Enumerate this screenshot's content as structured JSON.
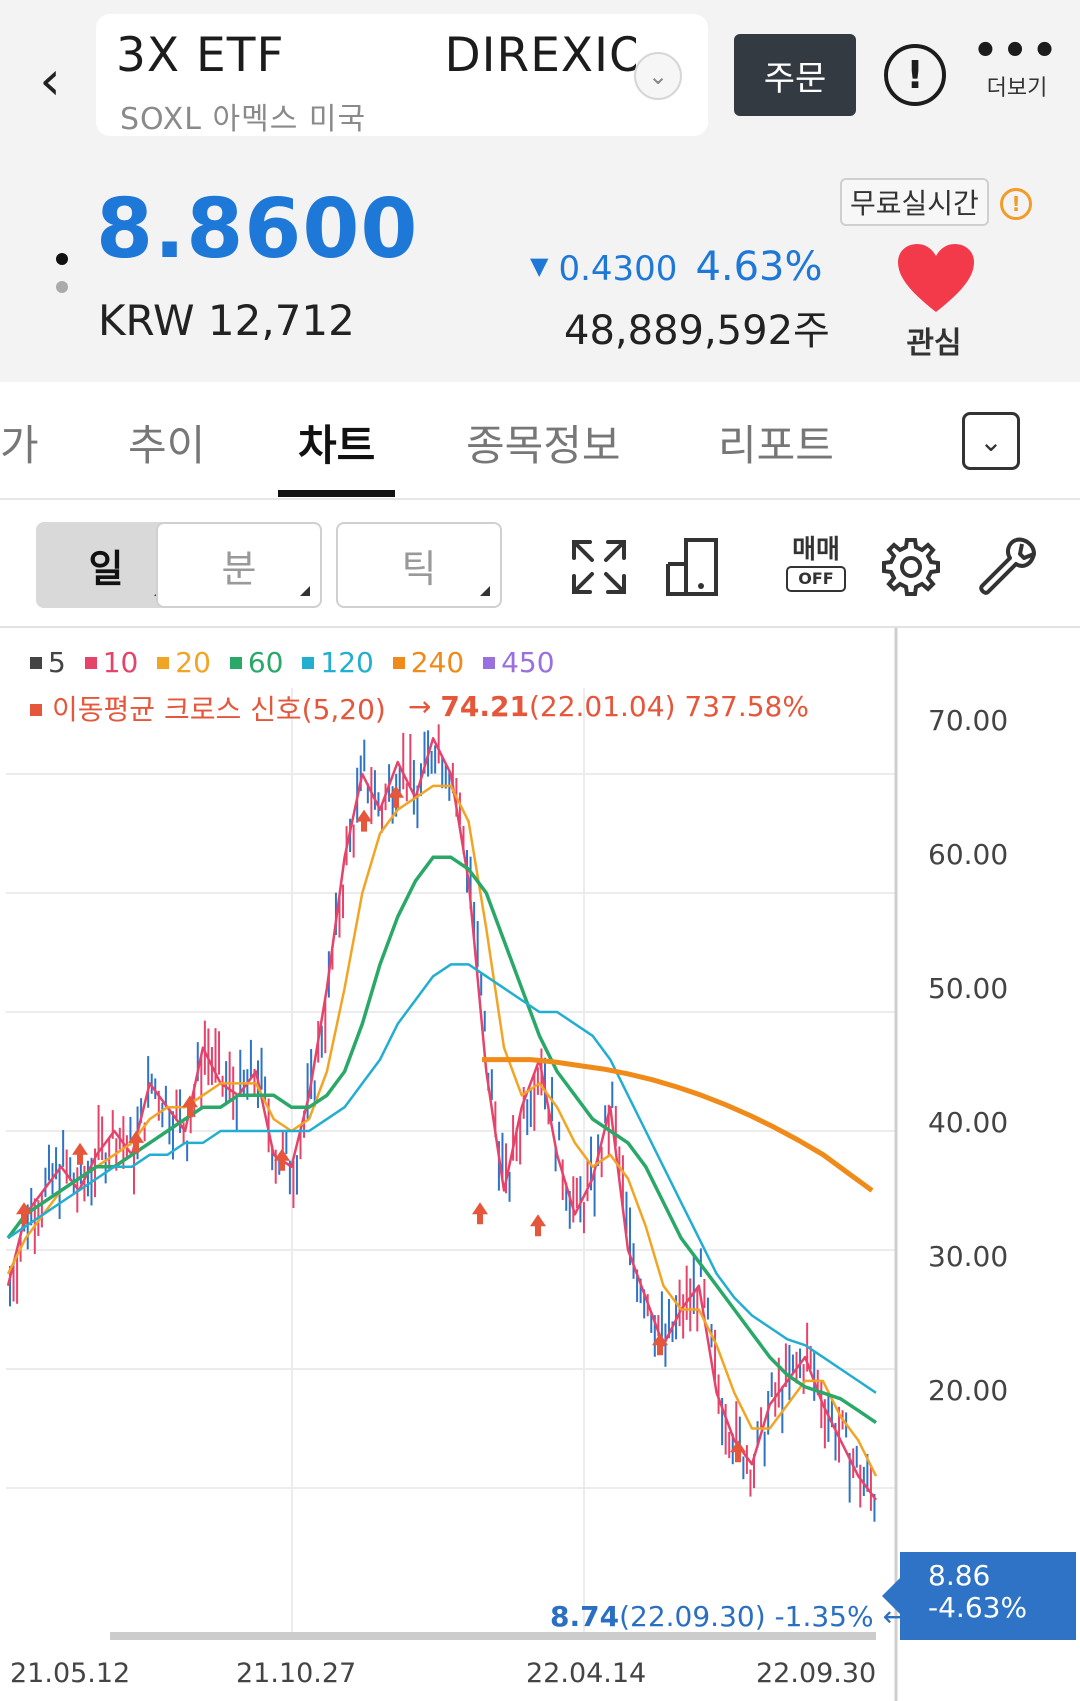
{
  "header": {
    "back_icon": "chevron-left-icon",
    "ticker_left": "3X ETF",
    "ticker_right": "DIREXIO",
    "subtitle": "SOXL 아멕스 미국",
    "order_label": "주문",
    "more_label": "더보기"
  },
  "quote": {
    "price": "8.8600",
    "krw": "KRW 12,712",
    "change_abs": "0.4300",
    "change_pct": "4.63%",
    "volume": "48,889,592주",
    "realtime_label": "무료실시간",
    "watch_label": "관심",
    "down_color": "#1e78d8",
    "heart_color": "#f23a4a"
  },
  "tabs": {
    "items": [
      "가",
      "추이",
      "차트",
      "종목정보",
      "리포트"
    ],
    "active": "차트"
  },
  "toolbar": {
    "periods": [
      "일",
      "분",
      "틱"
    ],
    "active_period": "일",
    "trade_label": "매매",
    "trade_state": "OFF"
  },
  "chart_legend": {
    "ma": [
      {
        "label": "5",
        "color": "#444444"
      },
      {
        "label": "10",
        "color": "#e6436b"
      },
      {
        "label": "20",
        "color": "#f2a524"
      },
      {
        "label": "60",
        "color": "#2aa868"
      },
      {
        "label": "120",
        "color": "#22aed1"
      },
      {
        "label": "240",
        "color": "#f08a18"
      },
      {
        "label": "450",
        "color": "#9a6fe0"
      }
    ],
    "signal_label": "이동평균 크로스 신호(5,20)",
    "high_value": "74.21",
    "high_date": "(22.01.04) 737.58%",
    "low_value": "8.74",
    "low_date": "(22.09.30) -1.35%",
    "current_value": "8.86",
    "current_pct": "-4.63%"
  },
  "chart_data": {
    "type": "line",
    "y_ticks": [
      "70.00",
      "60.00",
      "50.00",
      "40.00",
      "30.00",
      "20.00"
    ],
    "x_ticks": [
      "21.05.12",
      "21.10.27",
      "22.04.14",
      "22.09.30"
    ],
    "ylim": [
      8,
      75
    ],
    "series": [
      {
        "name": "5",
        "color": "#e6436b",
        "values": [
          27,
          33,
          35,
          37,
          35,
          38,
          40,
          38,
          44,
          42,
          40,
          47,
          44,
          43,
          45,
          38,
          37,
          43,
          52,
          63,
          70,
          67,
          71,
          68,
          73,
          70,
          61,
          45,
          35,
          42,
          46,
          38,
          33,
          36,
          42,
          30,
          26,
          22,
          25,
          27,
          18,
          14,
          12,
          17,
          19,
          21,
          17,
          14,
          11,
          9
        ]
      },
      {
        "name": "20",
        "color": "#f2a524",
        "values": [
          28,
          31,
          33,
          35,
          36,
          37,
          38,
          39,
          41,
          42,
          42,
          43,
          44,
          44,
          44,
          41,
          40,
          41,
          45,
          52,
          60,
          65,
          67,
          68,
          69,
          69,
          66,
          57,
          47,
          43,
          44,
          42,
          39,
          37,
          38,
          36,
          32,
          27,
          25,
          25,
          22,
          18,
          15,
          15,
          17,
          19,
          19,
          16,
          14,
          11
        ]
      },
      {
        "name": "60",
        "color": "#2aa868",
        "values": [
          31,
          33,
          34,
          35,
          36,
          37,
          37,
          38,
          39,
          40,
          41,
          42,
          42,
          43,
          43,
          43,
          42,
          42,
          43,
          45,
          49,
          54,
          58,
          61,
          63,
          63,
          62,
          60,
          56,
          52,
          48,
          45,
          43,
          41,
          40,
          39,
          37,
          34,
          31,
          29,
          27,
          25,
          23,
          21,
          19.5,
          18.5,
          18,
          17.5,
          16.5,
          15.5
        ]
      },
      {
        "name": "120",
        "color": "#22aed1",
        "values": [
          31,
          32,
          33,
          34,
          35,
          36,
          37,
          37,
          38,
          38,
          39,
          39,
          40,
          40,
          40,
          40,
          40,
          40,
          41,
          42,
          44,
          46,
          49,
          51,
          53,
          54,
          54,
          53,
          52,
          51,
          50,
          50,
          49,
          48,
          46,
          43,
          40,
          37,
          34,
          31,
          28,
          26,
          24.5,
          23.5,
          22.5,
          22,
          21,
          20,
          19,
          18
        ]
      },
      {
        "name": "240",
        "color": "#f08a18",
        "values": [
          46,
          46,
          46,
          45.8,
          45.5,
          45.2,
          44.8,
          44.3,
          43.7,
          43,
          42.2,
          41.3,
          40.3,
          39.2,
          38,
          36.5,
          35
        ]
      }
    ],
    "high": 74.21,
    "low": 8.74,
    "current": 8.86,
    "grid": true
  }
}
